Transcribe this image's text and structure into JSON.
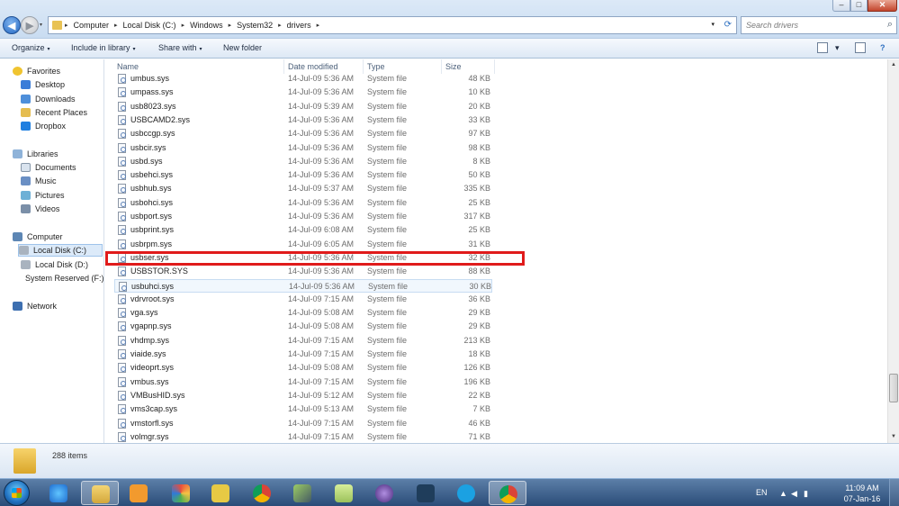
{
  "window": {
    "controls": {
      "minimize": "–",
      "maximize": "□",
      "close": "✕"
    }
  },
  "address": {
    "back_icon": "◀",
    "forward_icon": "▶",
    "crumbs": [
      "Computer",
      "Local Disk (C:)",
      "Windows",
      "System32",
      "drivers"
    ],
    "separator": "▸",
    "dropdown": "▾",
    "refresh_icon": "⟳"
  },
  "search": {
    "placeholder": "Search drivers",
    "icon": "⌕"
  },
  "toolbar": {
    "organize": "Organize",
    "include_in_library": "Include in library",
    "share_with": "Share with",
    "new_folder": "New folder",
    "caret": "▾"
  },
  "nav": {
    "favorites": "Favorites",
    "desktop": "Desktop",
    "downloads": "Downloads",
    "recent_places": "Recent Places",
    "dropbox": "Dropbox",
    "libraries": "Libraries",
    "documents": "Documents",
    "music": "Music",
    "pictures": "Pictures",
    "videos": "Videos",
    "computer": "Computer",
    "local_c": "Local Disk (C:)",
    "local_d": "Local Disk (D:)",
    "system_reserved": "System Reserved (F:)",
    "network": "Network"
  },
  "columns": {
    "name": "Name",
    "date": "Date modified",
    "type": "Type",
    "size": "Size"
  },
  "files": [
    {
      "name": "umbus.sys",
      "date": "14-Jul-09 5:36 AM",
      "type": "System file",
      "size": "48 KB"
    },
    {
      "name": "umpass.sys",
      "date": "14-Jul-09 5:36 AM",
      "type": "System file",
      "size": "10 KB"
    },
    {
      "name": "usb8023.sys",
      "date": "14-Jul-09 5:39 AM",
      "type": "System file",
      "size": "20 KB"
    },
    {
      "name": "USBCAMD2.sys",
      "date": "14-Jul-09 5:36 AM",
      "type": "System file",
      "size": "33 KB"
    },
    {
      "name": "usbccgp.sys",
      "date": "14-Jul-09 5:36 AM",
      "type": "System file",
      "size": "97 KB"
    },
    {
      "name": "usbcir.sys",
      "date": "14-Jul-09 5:36 AM",
      "type": "System file",
      "size": "98 KB"
    },
    {
      "name": "usbd.sys",
      "date": "14-Jul-09 5:36 AM",
      "type": "System file",
      "size": "8 KB"
    },
    {
      "name": "usbehci.sys",
      "date": "14-Jul-09 5:36 AM",
      "type": "System file",
      "size": "50 KB"
    },
    {
      "name": "usbhub.sys",
      "date": "14-Jul-09 5:37 AM",
      "type": "System file",
      "size": "335 KB"
    },
    {
      "name": "usbohci.sys",
      "date": "14-Jul-09 5:36 AM",
      "type": "System file",
      "size": "25 KB"
    },
    {
      "name": "usbport.sys",
      "date": "14-Jul-09 5:36 AM",
      "type": "System file",
      "size": "317 KB"
    },
    {
      "name": "usbprint.sys",
      "date": "14-Jul-09 6:08 AM",
      "type": "System file",
      "size": "25 KB"
    },
    {
      "name": "usbrpm.sys",
      "date": "14-Jul-09 6:05 AM",
      "type": "System file",
      "size": "31 KB"
    },
    {
      "name": "usbser.sys",
      "date": "14-Jul-09 5:36 AM",
      "type": "System file",
      "size": "32 KB"
    },
    {
      "name": "USBSTOR.SYS",
      "date": "14-Jul-09 5:36 AM",
      "type": "System file",
      "size": "88 KB"
    },
    {
      "name": "usbuhci.sys",
      "date": "14-Jul-09 5:36 AM",
      "type": "System file",
      "size": "30 KB"
    },
    {
      "name": "vdrvroot.sys",
      "date": "14-Jul-09 7:15 AM",
      "type": "System file",
      "size": "36 KB"
    },
    {
      "name": "vga.sys",
      "date": "14-Jul-09 5:08 AM",
      "type": "System file",
      "size": "29 KB"
    },
    {
      "name": "vgapnp.sys",
      "date": "14-Jul-09 5:08 AM",
      "type": "System file",
      "size": "29 KB"
    },
    {
      "name": "vhdmp.sys",
      "date": "14-Jul-09 7:15 AM",
      "type": "System file",
      "size": "213 KB"
    },
    {
      "name": "viaide.sys",
      "date": "14-Jul-09 7:15 AM",
      "type": "System file",
      "size": "18 KB"
    },
    {
      "name": "videoprt.sys",
      "date": "14-Jul-09 5:08 AM",
      "type": "System file",
      "size": "126 KB"
    },
    {
      "name": "vmbus.sys",
      "date": "14-Jul-09 7:15 AM",
      "type": "System file",
      "size": "196 KB"
    },
    {
      "name": "VMBusHID.sys",
      "date": "14-Jul-09 5:12 AM",
      "type": "System file",
      "size": "22 KB"
    },
    {
      "name": "vms3cap.sys",
      "date": "14-Jul-09 5:13 AM",
      "type": "System file",
      "size": "7 KB"
    },
    {
      "name": "vmstorfl.sys",
      "date": "14-Jul-09 7:15 AM",
      "type": "System file",
      "size": "46 KB"
    },
    {
      "name": "volmgr.sys",
      "date": "14-Jul-09 7:15 AM",
      "type": "System file",
      "size": "71 KB"
    }
  ],
  "highlighted_file": "usbser.sys",
  "hovered_file": "usbuhci.sys",
  "details": {
    "count": "288 items"
  },
  "taskbar": {
    "language": "EN",
    "time": "11:09 AM",
    "date": "07-Jan-16",
    "apps": [
      "internet-explorer",
      "windows-explorer",
      "media-player",
      "paint",
      "text-editor",
      "chrome",
      "tools",
      "folder-app",
      "media-app",
      "app-dark",
      "skype",
      "chrome"
    ]
  },
  "colors": {
    "annotation_red": "#e01b1b",
    "selection_blue": "#dceaf9",
    "taskbar": "#2a4c78"
  }
}
